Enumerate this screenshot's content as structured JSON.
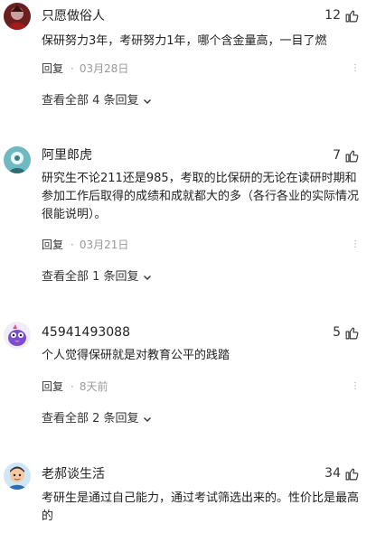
{
  "comments": [
    {
      "username": "只愿做俗人",
      "likes": "12",
      "content": "保研努力3年，考研努力1年，哪个含金量高，一目了燃",
      "reply_label": "回复",
      "separator": "·",
      "time": "03月28日",
      "view_replies": "查看全部 4 条回复",
      "avatar": "avatar-red-figure"
    },
    {
      "username": "阿里郎虎",
      "likes": "7",
      "content": "研究生不论211还是985，考取的比保研的无论在读研时期和参加工作后取得的成绩和成就都大的多（各行各业的实际情况很能说明）。",
      "reply_label": "回复",
      "separator": "·",
      "time": "03月21日",
      "view_replies": "查看全部 1 条回复",
      "avatar": "avatar-teal-person"
    },
    {
      "username": "45941493088",
      "likes": "5",
      "content": "个人觉得保研就是对教育公平的践踏",
      "reply_label": "回复",
      "separator": "·",
      "time": "8天前",
      "view_replies": "查看全部 2 条回复",
      "avatar": "avatar-cartoon-bird"
    },
    {
      "username": "老郝谈生活",
      "likes": "34",
      "content": "考研生是通过自己能力，通过考试筛选出来的。性价比是最高的",
      "avatar": "avatar-cartoon-man"
    }
  ],
  "icons": {
    "like": "thumbs-up-icon",
    "more": "more-icon",
    "expand": "chevron-down-icon"
  },
  "colors": {
    "text": "#222222",
    "muted": "#999999",
    "icon": "#a0a0a0"
  }
}
